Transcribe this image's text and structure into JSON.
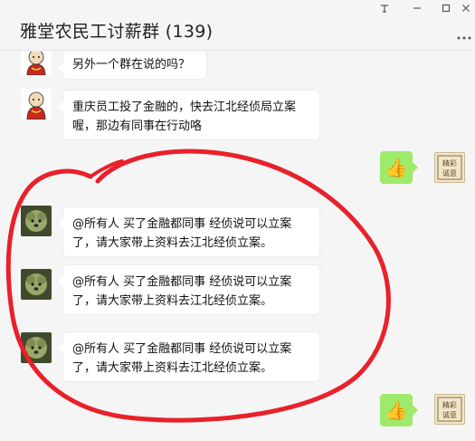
{
  "window": {
    "title": "雅堂农民工讨薪群 (139)",
    "controls": [
      "pin-icon",
      "minimize-icon",
      "maximize-icon",
      "close-icon"
    ]
  },
  "messages": [
    {
      "sender": "other",
      "avatar": "monk-cartoon-avatar",
      "text": "另外一个群在说的吗？"
    },
    {
      "sender": "other",
      "avatar": "monk-cartoon-avatar",
      "text_line1": "重庆员工投了金融的，快去江北经侦局立案",
      "text_line2": "喔，那边有同事在行动咯"
    },
    {
      "sender": "self",
      "avatar": "seal-avatar",
      "content": "thumbs-up-icon"
    },
    {
      "sender": "other",
      "avatar": "dog-photo-avatar",
      "text_line1": "@所有人 买了金融都同事  经侦说可以立案",
      "text_line2": "了，请大家带上资料去江北经侦立案。"
    },
    {
      "sender": "other",
      "avatar": "dog-photo-avatar",
      "text_line1": "@所有人 买了金融都同事  经侦说可以立案",
      "text_line2": "了，请大家带上资料去江北经侦立案。"
    },
    {
      "sender": "other",
      "avatar": "dog-photo-avatar",
      "text_line1": "@所有人 买了金融都同事  经侦说可以立案",
      "text_line2": "了，请大家带上资料去江北经侦立案。"
    },
    {
      "sender": "self",
      "avatar": "seal-avatar",
      "content": "thumbs-up-icon"
    }
  ],
  "seal_text": "精彩诚意",
  "colors": {
    "self_bubble": "#9eea6a",
    "other_bubble": "#ffffff",
    "annotation": "#e8212a",
    "background": "#f5f5f5"
  }
}
